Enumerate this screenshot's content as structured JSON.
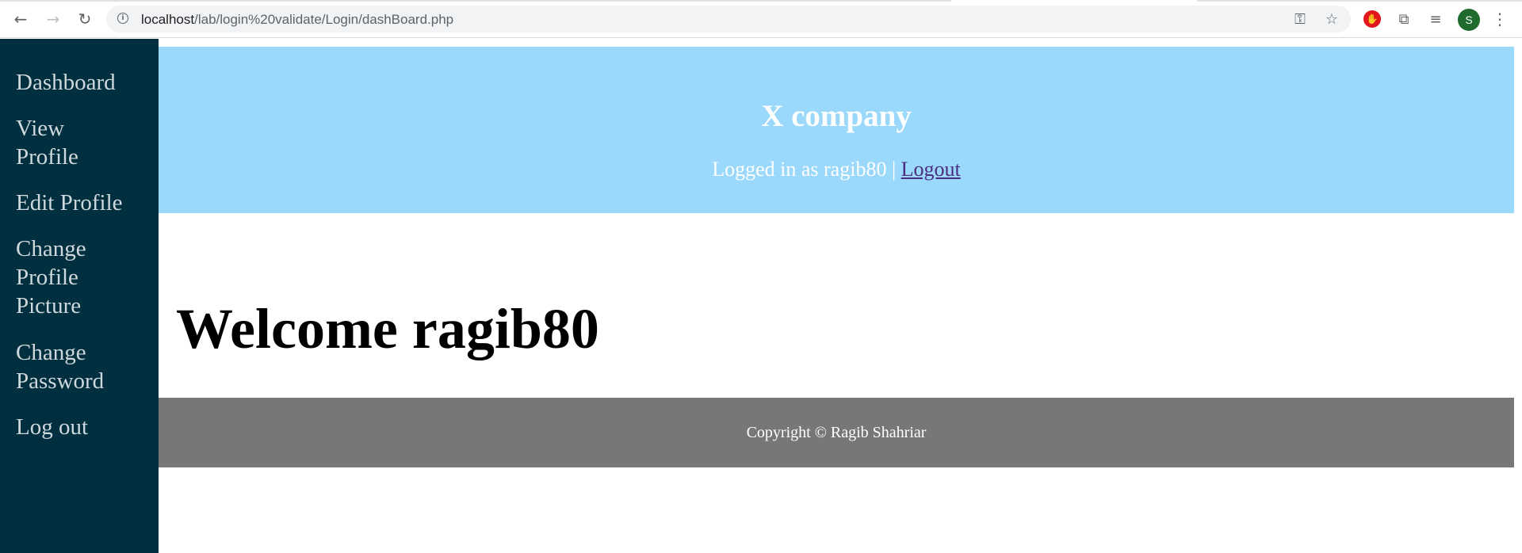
{
  "browser": {
    "url_host": "localhost",
    "url_path": "/lab/login%20validate/Login/dashBoard.php",
    "back_icon": "arrow-left-icon",
    "forward_icon": "arrow-right-icon",
    "reload_icon": "reload-icon",
    "info_icon": "info-icon",
    "key_icon": "key-icon",
    "star_icon": "star-icon",
    "extensions": [
      "adblock-icon",
      "puzzle-icon",
      "media-queue-icon"
    ],
    "profile_initial": "S",
    "menu_icon": "more-vert-icon"
  },
  "sidebar": {
    "items": [
      {
        "label": "Dashboard"
      },
      {
        "label": "View Profile"
      },
      {
        "label": "Edit Profile"
      },
      {
        "label": "Change Profile Picture"
      },
      {
        "label": "Change Password"
      },
      {
        "label": "Log out"
      }
    ]
  },
  "header": {
    "title": "X company",
    "logged_in_text": "Logged in as ragib80 |",
    "logout_label": "Logout"
  },
  "main": {
    "welcome": "Welcome ragib80"
  },
  "footer": {
    "copyright": "Copyright © Ragib Shahriar"
  },
  "colors": {
    "sidebar_bg": "#00303f",
    "header_bg": "#9ad8fc",
    "footer_bg": "#777777",
    "link_visited": "#4b2c80"
  }
}
